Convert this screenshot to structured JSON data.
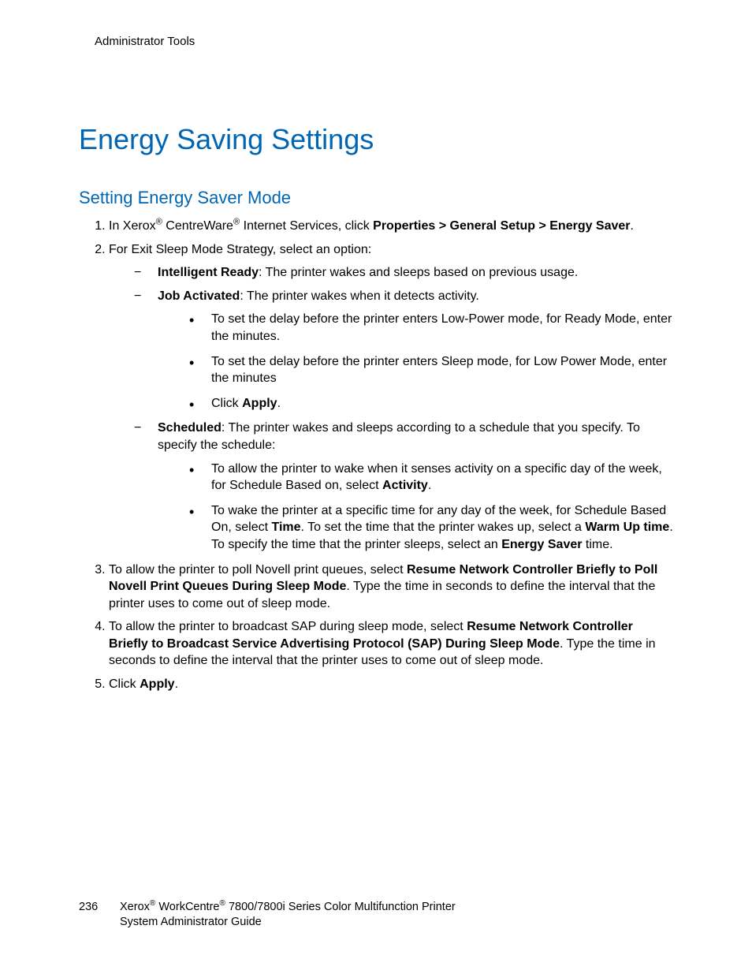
{
  "header": "Administrator Tools",
  "title": "Energy Saving Settings",
  "subtitle": "Setting Energy Saver Mode",
  "list": {
    "i1_pre": "In Xerox",
    "i1_mid": " CentreWare",
    "i1_post": " Internet Services, click ",
    "i1_path": "Properties > General Setup > Energy Saver",
    "i1_end": ".",
    "i2": "For Exit Sleep Mode Strategy, select an option:",
    "i2a_b": "Intelligent Ready",
    "i2a_t": ": The printer wakes and sleeps based on previous usage.",
    "i2b_b": "Job Activated",
    "i2b_t": ": The printer wakes when it detects activity.",
    "i2b_1": "To set the delay before the printer enters Low-Power mode, for Ready Mode, enter the minutes.",
    "i2b_2": "To set the delay before the printer enters Sleep mode, for Low Power Mode, enter the minutes",
    "i2b_3_pre": "Click ",
    "i2b_3_b": "Apply",
    "i2b_3_post": ".",
    "i2c_b": "Scheduled",
    "i2c_t": ": The printer wakes and sleeps according to a schedule that you specify. To specify the schedule:",
    "i2c_1_pre": "To allow the printer to wake when it senses activity on a specific day of the week, for Schedule Based on, select ",
    "i2c_1_b": "Activity",
    "i2c_1_post": ".",
    "i2c_2_pre": "To wake the printer at a specific time for any day of the week, for Schedule Based On, select ",
    "i2c_2_b1": "Time",
    "i2c_2_mid": ". To set the time that the printer wakes up, select a ",
    "i2c_2_b2": "Warm Up time",
    "i2c_2_mid2": ". To specify the time that the printer sleeps, select an ",
    "i2c_2_b3": "Energy Saver",
    "i2c_2_post": " time.",
    "i3_pre": "To allow the printer to poll Novell print queues, select ",
    "i3_b": "Resume Network Controller Briefly to Poll Novell Print Queues During Sleep Mode",
    "i3_post": ". Type the time in seconds to define the interval that the printer uses to come out of sleep mode.",
    "i4_pre": "To allow the printer to broadcast SAP during sleep mode, select ",
    "i4_b": "Resume Network Controller Briefly to Broadcast Service Advertising Protocol (SAP) During Sleep Mode",
    "i4_post": ". Type the time in seconds to define the interval that the printer uses to come out of sleep mode.",
    "i5_pre": "Click ",
    "i5_b": "Apply",
    "i5_post": "."
  },
  "footer": {
    "page": "236",
    "l1a": "Xerox",
    "l1b": " WorkCentre",
    "l1c": " 7800/7800i Series Color Multifunction Printer",
    "l2": "System Administrator Guide"
  },
  "reg": "®"
}
